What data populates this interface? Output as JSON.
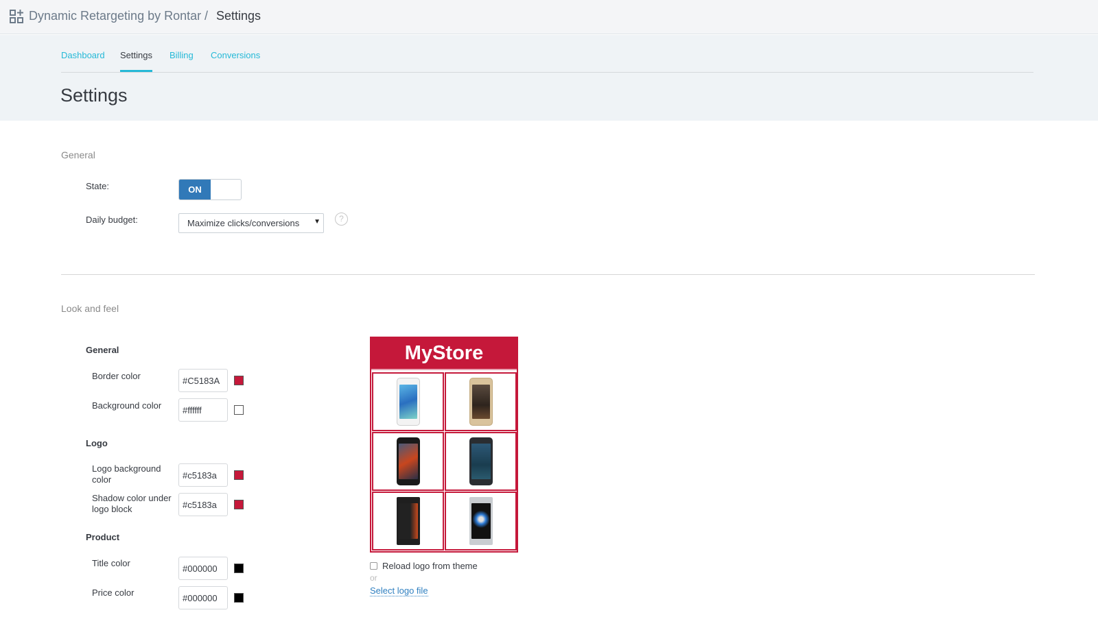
{
  "topbar": {
    "app_icon": "apps-add-icon",
    "app_name": "Dynamic Retargeting by Rontar",
    "separator": "/",
    "current": "Settings"
  },
  "tabs": [
    {
      "label": "Dashboard",
      "active": false
    },
    {
      "label": "Settings",
      "active": true
    },
    {
      "label": "Billing",
      "active": false
    },
    {
      "label": "Conversions",
      "active": false
    }
  ],
  "page_title": "Settings",
  "general": {
    "title": "General",
    "state_label": "State:",
    "state_value": "ON",
    "budget_label": "Daily budget:",
    "budget_value": "Maximize clicks/conversions",
    "help_icon": "?"
  },
  "look_and_feel": {
    "title": "Look and feel",
    "groups": {
      "general": {
        "title": "General",
        "fields": [
          {
            "label": "Border color",
            "value": "#C5183A",
            "swatch": "#c5183a"
          },
          {
            "label": "Background color",
            "value": "#ffffff",
            "swatch": "#ffffff"
          }
        ]
      },
      "logo": {
        "title": "Logo",
        "fields": [
          {
            "label": "Logo background color",
            "value": "#c5183a",
            "swatch": "#c5183a"
          },
          {
            "label": "Shadow color under logo block",
            "value": "#c5183a",
            "swatch": "#c5183a"
          }
        ]
      },
      "product": {
        "title": "Product",
        "fields": [
          {
            "label": "Title color",
            "value": "#000000",
            "swatch": "#000000"
          },
          {
            "label": "Price color",
            "value": "#000000",
            "swatch": "#000000"
          }
        ]
      }
    }
  },
  "preview": {
    "logo_text": "MyStore",
    "border_color": "#c5183a",
    "products": [
      {
        "name": "white-smartphone"
      },
      {
        "name": "gold-smartphone"
      },
      {
        "name": "black-smartphone-orange-wallpaper"
      },
      {
        "name": "black-smartphone-blue-screen"
      },
      {
        "name": "black-smartphone-clock"
      },
      {
        "name": "silver-smartphone"
      }
    ],
    "reload_label": "Reload logo from theme",
    "reload_checked": false,
    "or_text": "or",
    "select_logo_label": "Select logo file"
  }
}
